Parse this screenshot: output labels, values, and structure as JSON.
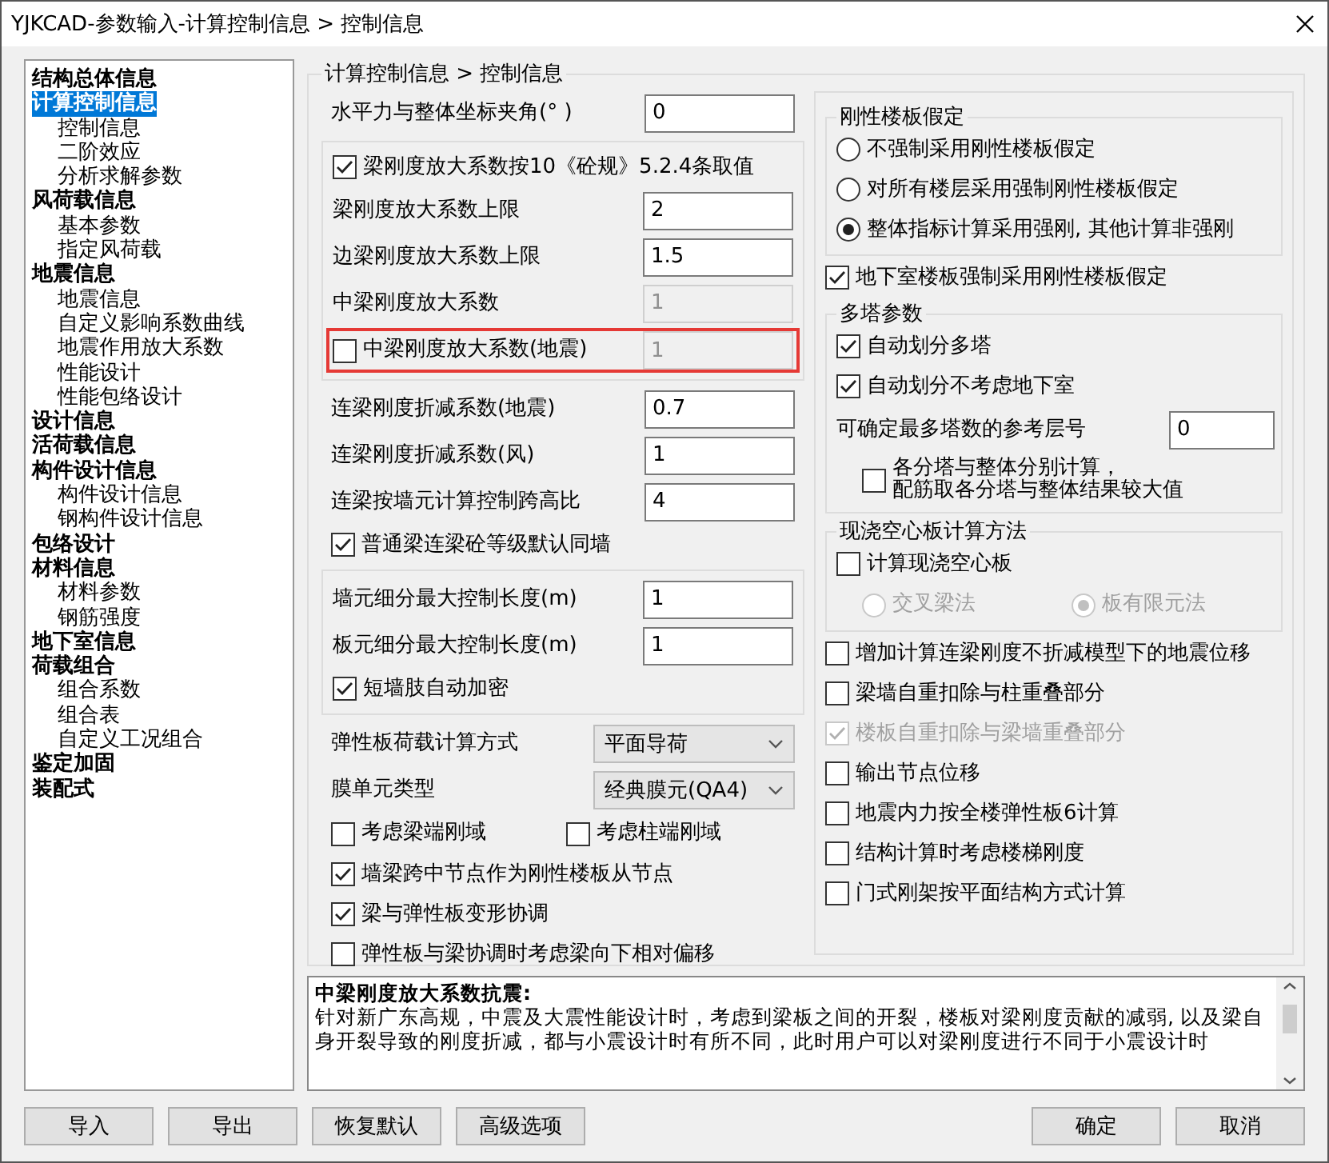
{
  "window": {
    "title": "YJKCAD-参数输入-计算控制信息 > 控制信息"
  },
  "sidebar": {
    "items": [
      {
        "label": "结构总体信息",
        "selected": false
      },
      {
        "label": "计算控制信息",
        "selected": true,
        "children": [
          {
            "label": "控制信息",
            "selected": false
          },
          {
            "label": "二阶效应",
            "selected": false
          },
          {
            "label": "分析求解参数",
            "selected": false
          }
        ]
      },
      {
        "label": "风荷载信息",
        "selected": false,
        "children": [
          {
            "label": "基本参数",
            "selected": false
          },
          {
            "label": "指定风荷载",
            "selected": false
          }
        ]
      },
      {
        "label": "地震信息",
        "selected": false,
        "children": [
          {
            "label": "地震信息",
            "selected": false
          },
          {
            "label": "自定义影响系数曲线",
            "selected": false
          },
          {
            "label": "地震作用放大系数",
            "selected": false
          },
          {
            "label": "性能设计",
            "selected": false
          },
          {
            "label": "性能包络设计",
            "selected": false
          }
        ]
      },
      {
        "label": "设计信息",
        "selected": false
      },
      {
        "label": "活荷载信息",
        "selected": false
      },
      {
        "label": "构件设计信息",
        "selected": false,
        "children": [
          {
            "label": "构件设计信息",
            "selected": false
          },
          {
            "label": "钢构件设计信息",
            "selected": false
          }
        ]
      },
      {
        "label": "包络设计",
        "selected": false
      },
      {
        "label": "材料信息",
        "selected": false,
        "children": [
          {
            "label": "材料参数",
            "selected": false
          },
          {
            "label": "钢筋强度",
            "selected": false
          }
        ]
      },
      {
        "label": "地下室信息",
        "selected": false
      },
      {
        "label": "荷载组合",
        "selected": false,
        "children": [
          {
            "label": "组合系数",
            "selected": false
          },
          {
            "label": "组合表",
            "selected": false
          },
          {
            "label": "自定义工况组合",
            "selected": false
          }
        ]
      },
      {
        "label": "鉴定加固",
        "selected": false
      },
      {
        "label": "装配式",
        "selected": false
      }
    ]
  },
  "panel": {
    "title": "计算控制信息 > 控制信息",
    "left": [
      {
        "kind": "plain",
        "rows": [
          {
            "kind": "field",
            "label": "水平力与整体坐标夹角(° )",
            "value": "0",
            "disabled": false
          }
        ]
      },
      {
        "kind": "group",
        "rows": [
          {
            "kind": "checkbox",
            "label": "梁刚度放大系数按10《砼规》5.2.4条取值",
            "checked": true,
            "disabled": false
          },
          {
            "kind": "field",
            "label": "梁刚度放大系数上限",
            "value": "2",
            "disabled": false
          },
          {
            "kind": "field",
            "label": "边梁刚度放大系数上限",
            "value": "1.5",
            "disabled": false
          },
          {
            "kind": "field",
            "label": "中梁刚度放大系数",
            "value": "1",
            "disabled": true
          },
          {
            "kind": "checkfield",
            "label": "中梁刚度放大系数(地震)",
            "checked": false,
            "value": "1",
            "disabled": true,
            "highlighted": true
          }
        ]
      },
      {
        "kind": "plain",
        "rows": [
          {
            "kind": "field",
            "label": "连梁刚度折减系数(地震)",
            "value": "0.7",
            "disabled": false
          },
          {
            "kind": "field",
            "label": "连梁刚度折减系数(风)",
            "value": "1",
            "disabled": false
          },
          {
            "kind": "field",
            "label": "连梁按墙元计算控制跨高比",
            "value": "4",
            "disabled": false
          },
          {
            "kind": "checkbox",
            "label": "普通梁连梁砼等级默认同墙",
            "checked": true,
            "disabled": false
          }
        ]
      },
      {
        "kind": "group",
        "rows": [
          {
            "kind": "field",
            "label": "墙元细分最大控制长度(m)",
            "value": "1",
            "disabled": false
          },
          {
            "kind": "field",
            "label": "板元细分最大控制长度(m)",
            "value": "1",
            "disabled": false
          },
          {
            "kind": "checkbox",
            "label": "短墙肢自动加密",
            "checked": true,
            "disabled": false
          }
        ]
      },
      {
        "kind": "plain",
        "rows": [
          {
            "kind": "select",
            "label": "弹性板荷载计算方式",
            "value": "平面导荷"
          },
          {
            "kind": "select",
            "label": "膜单元类型",
            "value": "经典膜元(QA4)"
          },
          {
            "kind": "checkpair",
            "items": [
              {
                "label": "考虑梁端刚域",
                "checked": false
              },
              {
                "label": "考虑柱端刚域",
                "checked": false
              }
            ]
          },
          {
            "kind": "checkbox",
            "label": "墙梁跨中节点作为刚性楼板从节点",
            "checked": true,
            "disabled": false
          },
          {
            "kind": "checkbox",
            "label": "梁与弹性板变形协调",
            "checked": true,
            "disabled": false
          },
          {
            "kind": "checkbox",
            "label": "弹性板与梁协调时考虑梁向下相对偏移",
            "checked": false,
            "disabled": false
          }
        ]
      }
    ],
    "right": [
      {
        "kind": "group",
        "title": "刚性楼板假定",
        "rows": [
          {
            "kind": "radio",
            "label": "不强制采用刚性楼板假定",
            "selected": false,
            "disabled": false
          },
          {
            "kind": "radio",
            "label": "对所有楼层采用强制刚性楼板假定",
            "selected": false,
            "disabled": false
          },
          {
            "kind": "radio",
            "label": "整体指标计算采用强刚, 其他计算非强刚",
            "selected": true,
            "disabled": false
          }
        ]
      },
      {
        "kind": "plain",
        "rows": [
          {
            "kind": "checkbox",
            "label": "地下室楼板强制采用刚性楼板假定",
            "checked": true,
            "disabled": false
          }
        ]
      },
      {
        "kind": "group",
        "title": "多塔参数",
        "rows": [
          {
            "kind": "checkbox",
            "label": "自动划分多塔",
            "checked": true,
            "disabled": false
          },
          {
            "kind": "checkbox",
            "label": "自动划分不考虑地下室",
            "checked": true,
            "disabled": false
          },
          {
            "kind": "field",
            "label": "可确定最多塔数的参考层号",
            "value": "0",
            "disabled": false
          },
          {
            "kind": "wrapcheck",
            "lines": [
              "各分塔与整体分别计算，",
              "配筋取各分塔与整体结果较大值"
            ],
            "checked": false,
            "disabled": false
          }
        ]
      },
      {
        "kind": "group",
        "title": "现浇空心板计算方法",
        "rows": [
          {
            "kind": "checkbox",
            "label": "计算现浇空心板",
            "checked": false,
            "disabled": false
          },
          {
            "kind": "radiopair",
            "disabled": true,
            "items": [
              {
                "label": "交叉梁法",
                "selected": false
              },
              {
                "label": "板有限元法",
                "selected": true
              }
            ]
          }
        ]
      },
      {
        "kind": "plain",
        "rows": [
          {
            "kind": "checkbox",
            "label": "增加计算连梁刚度不折减模型下的地震位移",
            "checked": false,
            "disabled": false
          },
          {
            "kind": "checkbox",
            "label": "梁墙自重扣除与柱重叠部分",
            "checked": false,
            "disabled": false
          },
          {
            "kind": "checkbox",
            "label": "楼板自重扣除与梁墙重叠部分",
            "checked": true,
            "disabled": true
          },
          {
            "kind": "checkbox",
            "label": "输出节点位移",
            "checked": false,
            "disabled": false
          },
          {
            "kind": "checkbox",
            "label": "地震内力按全楼弹性板6计算",
            "checked": false,
            "disabled": false
          },
          {
            "kind": "checkbox",
            "label": "结构计算时考虑楼梯刚度",
            "checked": false,
            "disabled": false
          },
          {
            "kind": "checkbox",
            "label": "门式刚架按平面结构方式计算",
            "checked": false,
            "disabled": false
          }
        ]
      }
    ]
  },
  "description": {
    "title": "中梁刚度放大系数抗震:",
    "text": "针对新广东高规，中震及大震性能设计时，考虑到梁板之间的开裂，楼板对梁刚度贡献的减弱, 以及梁自身开裂导致的刚度折减，都与小震设计时有所不同，此时用户可以对梁刚度进行不同于小震设计时"
  },
  "buttons": {
    "left": [
      "导入",
      "导出",
      "恢复默认",
      "高级选项"
    ],
    "right": [
      "确定",
      "取消"
    ]
  }
}
